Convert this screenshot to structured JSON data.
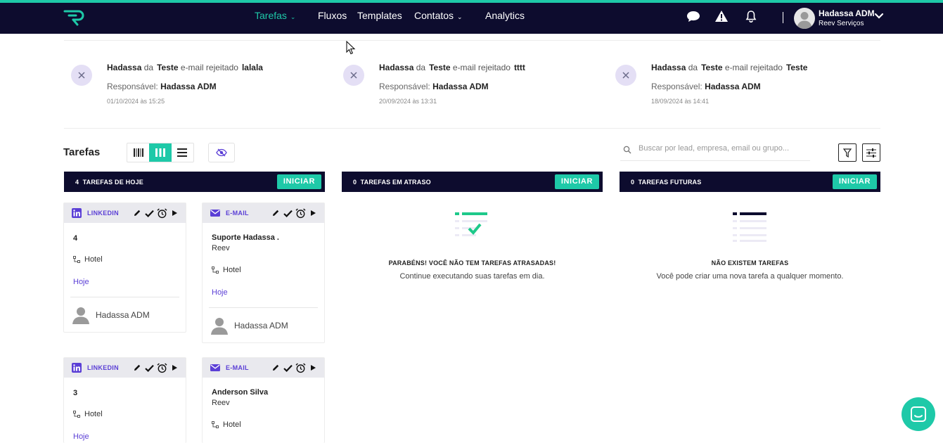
{
  "nav": {
    "items": [
      {
        "label": "Tarefas",
        "dropdown": true,
        "active": true
      },
      {
        "label": "Fluxos"
      },
      {
        "label": "Templates"
      },
      {
        "label": "Contatos",
        "dropdown": true
      },
      {
        "label": "Analytics"
      }
    ],
    "icons": [
      "chat-icon",
      "alert-icon",
      "bell-icon"
    ],
    "user": {
      "name": "Hadassa ADM",
      "company": "Reev Serviços"
    }
  },
  "notifications": [
    {
      "who": "Hadassa",
      "from_word": "da",
      "template": "Teste",
      "event": "e-mail rejeitado",
      "subject": "lalala",
      "responsible_label": "Responsável:",
      "responsible": "Hadassa ADM",
      "date": "01/10/2024 às 15:25"
    },
    {
      "who": "Hadassa",
      "from_word": "da",
      "template": "Teste",
      "event": "e-mail rejeitado",
      "subject": "tttt",
      "responsible_label": "Responsável:",
      "responsible": "Hadassa ADM",
      "date": "20/09/2024 às 13:31"
    },
    {
      "who": "Hadassa",
      "from_word": "da",
      "template": "Teste",
      "event": "e-mail rejeitado",
      "subject": "Teste",
      "responsible_label": "Responsável:",
      "responsible": "Hadassa ADM",
      "date": "18/09/2024 às 14:41"
    }
  ],
  "tasks": {
    "title": "Tarefas",
    "search_placeholder": "Buscar por lead, empresa, email ou grupo...",
    "columns": [
      {
        "count": "4",
        "label": "TAREFAS DE HOJE",
        "button": "INICIAR"
      },
      {
        "count": "0",
        "label": "TAREFAS EM ATRASO",
        "button": "INICIAR",
        "empty_title": "PARABÉNS! VOCÊ NÃO TEM TAREFAS ATRASADAS!",
        "empty_text": "Continue executando suas tarefas em dia."
      },
      {
        "count": "0",
        "label": "TAREFAS FUTURAS",
        "button": "INICIAR",
        "empty_title": "NÃO EXISTEM TAREFAS",
        "empty_text": "Você pode criar uma nova tarefa a qualquer momento."
      }
    ],
    "cards": [
      {
        "type": "LINKEDIN",
        "title": "4",
        "company": "Hotel",
        "due": "Hoje",
        "owner": "Hadassa ADM"
      },
      {
        "type": "E-MAIL",
        "title": "Suporte Hadassa .",
        "subtitle": "Reev",
        "company": "Hotel",
        "due": "Hoje",
        "owner": "Hadassa ADM"
      },
      {
        "type": "LINKEDIN",
        "title": "3",
        "company": "Hotel",
        "due": "Hoje"
      },
      {
        "type": "E-MAIL",
        "title": "Anderson Silva",
        "subtitle": "Reev",
        "company": "Hotel"
      }
    ]
  },
  "colors": {
    "brand": "#0d0c2e",
    "accent": "#1ec9a8",
    "purple": "#5b3fd6"
  }
}
